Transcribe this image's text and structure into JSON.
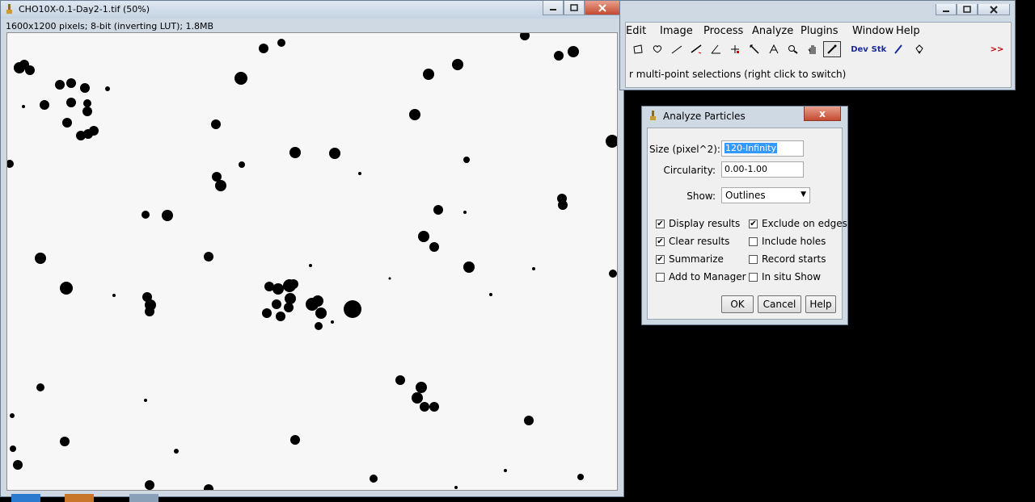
{
  "image_window": {
    "title": "CHO10X-0.1-Day2-1.tif (50%)",
    "info": "1600x1200 pixels; 8-bit (inverting LUT); 1.8MB"
  },
  "imagej": {
    "menus": [
      "Edit",
      "Image",
      "Process",
      "Analyze",
      "Plugins",
      "Window",
      "Help"
    ],
    "tools": [
      "rectangle-icon",
      "oval-icon",
      "polygon-icon",
      "line-icon",
      "angle-icon",
      "multipoint-icon",
      "wand-icon",
      "text-icon",
      "magnifier-icon",
      "hand-icon",
      "color-picker-icon",
      "Dev",
      "Stk",
      "brush-icon",
      "flood-fill-icon",
      "more-tools-icon"
    ],
    "dev_label": "Dev",
    "stk_label": "Stk",
    "more_label": ">>",
    "status": "r multi-point selections (right click to switch)",
    "menu_first": "Edit",
    "menu_image": "Image",
    "menu_process": "Process",
    "menu_analyze": "Analyze",
    "menu_plugins": "Plugins",
    "menu_window": "Window",
    "menu_help": "Help"
  },
  "dialog": {
    "title": "Analyze Particles",
    "close_label": "x",
    "size_label": "Size (pixel^2):",
    "size_value": "120-Infinity",
    "circularity_label": "Circularity:",
    "circularity_value": "0.00-1.00",
    "show_label": "Show:",
    "show_value": "Outlines",
    "checkboxes": {
      "display_results": {
        "label": "Display results",
        "checked": true
      },
      "exclude_on_edges": {
        "label": "Exclude on edges",
        "checked": true
      },
      "clear_results": {
        "label": "Clear results",
        "checked": true
      },
      "include_holes": {
        "label": "Include holes",
        "checked": false
      },
      "summarize": {
        "label": "Summarize",
        "checked": true
      },
      "record_starts": {
        "label": "Record starts",
        "checked": false
      },
      "add_to_manager": {
        "label": "Add to Manager",
        "checked": false
      },
      "in_situ_show": {
        "label": "In situ Show",
        "checked": false
      }
    },
    "ok_label": "OK",
    "cancel_label": "Cancel",
    "help_label": "Help",
    "check_mark": "✔"
  },
  "colors": {
    "selection": "#3399ff",
    "close_button": "#c54a30",
    "window_frame": "#cfd9e4"
  }
}
